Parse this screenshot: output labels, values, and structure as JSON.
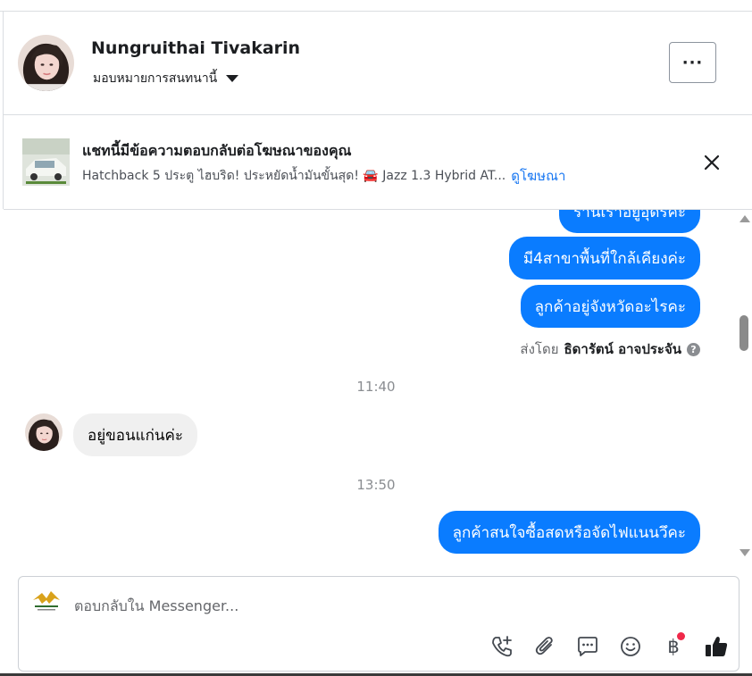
{
  "header": {
    "contact_name": "Nungruithai Tivakarin",
    "assign_label": "มอบหมายการสนทนานี้",
    "more_label": "···"
  },
  "ad_banner": {
    "title": "แชทนี้มีข้อความตอบกลับต่อโฆษณาของคุณ",
    "subtitle": "Hatchback 5 ประตู ไฮบริด! ประหยัดน้ำมันขั้นสุด! 🚘 Jazz 1.3 Hybrid AT...",
    "link_label": "ดูโฆษณา",
    "close_icon": "close-icon"
  },
  "messages": [
    {
      "direction": "out",
      "text": "ร้านเราอยู่อุดรค่ะ"
    },
    {
      "direction": "out",
      "text": "มี4สาขาพื้นที่ใกล้เคียงค่ะ"
    },
    {
      "direction": "out",
      "text": "ลูกค้าอยู่จังหวัดอะไรคะ"
    },
    {
      "direction": "in",
      "text": "อยู่ขอนแก่นค่ะ"
    },
    {
      "direction": "out",
      "text": "ลูกค้าสนใจซื้อสดหรือจัดไฟแนนวึคะ"
    }
  ],
  "sent_by": {
    "prefix": "ส่งโดย",
    "sender": "ธิดารัตน์ อาจประจัน",
    "help": "?"
  },
  "timestamps": [
    "11:40",
    "13:50"
  ],
  "composer": {
    "placeholder": "ตอบกลับใน Messenger...",
    "value": "",
    "tools": [
      "phone-add-icon",
      "paperclip-icon",
      "chat-bubble-icon",
      "emoji-icon",
      "baht-payment-icon",
      "thumbs-up-icon"
    ],
    "baht_symbol": "฿"
  },
  "colors": {
    "outgoing_bubble": "#0a7cff",
    "incoming_bubble": "#f0f0f0",
    "link": "#1877f2",
    "notification_dot": "#f02849"
  }
}
